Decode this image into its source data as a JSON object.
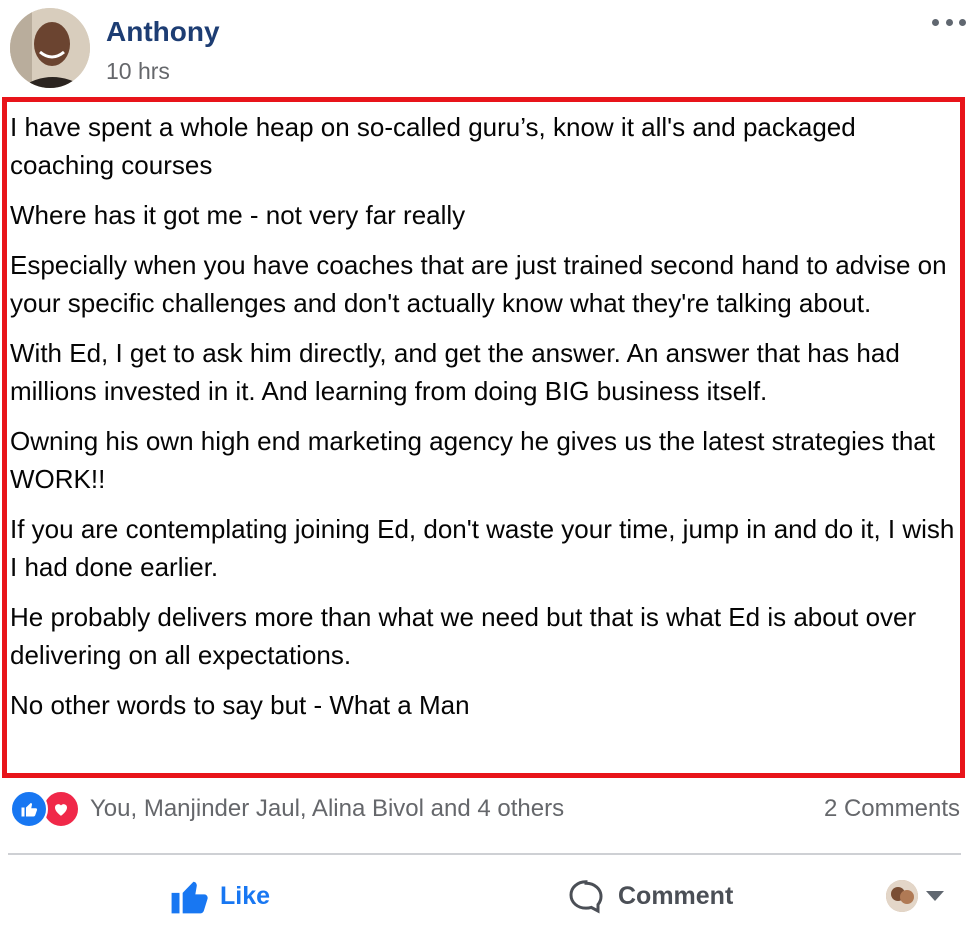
{
  "post": {
    "author": "Anthony",
    "time": "10 hrs",
    "paragraphs": [
      "I have spent a whole heap on so-called guru’s, know it all's and packaged coaching courses",
      "Where has it got me - not very far really",
      "Especially when you have coaches that are just trained second hand to advise on your specific challenges and don't actually know what they're talking about.",
      "With Ed, I get to ask him directly, and get the answer. An answer that has had millions invested in it. And learning from doing BIG business itself.",
      "Owning his own high end marketing agency he gives us the latest strategies that WORK!!",
      "If you are contemplating joining Ed, don't waste your time, jump in and do it, I wish I had done earlier.",
      "He probably delivers more than what we need but that is what Ed is about over delivering on all expectations.",
      "No other words to say but - What a Man"
    ]
  },
  "reactions": {
    "names": "You, Manjinder Jaul, Alina Bivol and 4 others",
    "comments": "2 Comments",
    "icons": [
      "like-icon",
      "love-icon"
    ]
  },
  "actions": {
    "like_label": "Like",
    "comment_label": "Comment"
  },
  "colors": {
    "author": "#1d3d73",
    "highlight_border": "#e8141a",
    "facebook_blue": "#1877f2",
    "love_red": "#f02849",
    "muted_text": "#65676b"
  }
}
